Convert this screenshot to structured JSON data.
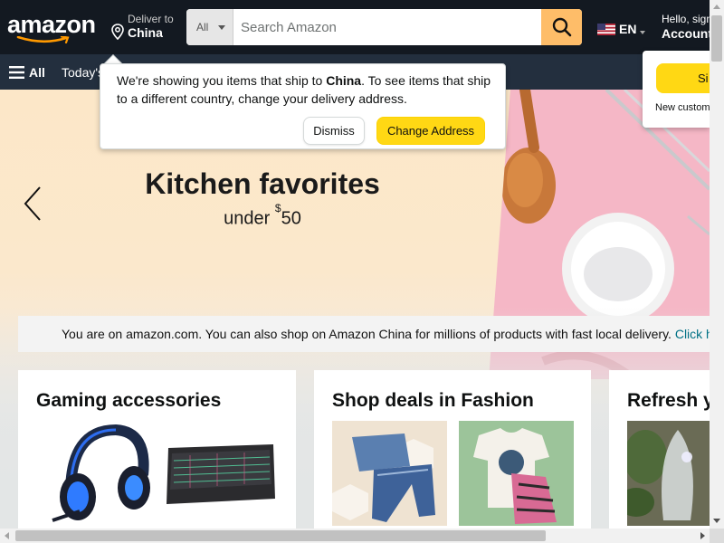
{
  "header": {
    "logo_text": "amazon",
    "deliver_label": "Deliver to",
    "deliver_country": "China",
    "search": {
      "category": "All",
      "placeholder": "Search Amazon"
    },
    "language": "EN",
    "account_greeting": "Hello, sign",
    "account_label": "Account"
  },
  "subnav": {
    "all_label": "All",
    "today_deals": "Today's"
  },
  "popover": {
    "message_prefix": "We're showing you items that ship to ",
    "message_country": "China",
    "message_suffix": ". To see items that ship to a different country, change your delivery address.",
    "dismiss_label": "Dismiss",
    "change_label": "Change Address"
  },
  "signin_flyout": {
    "button_label": "Si",
    "new_customer": "New custom"
  },
  "hero": {
    "title": "Kitchen favorites",
    "subtitle_prefix": "under ",
    "subtitle_currency": "$",
    "subtitle_amount": "50"
  },
  "notice": {
    "text": "You are on amazon.com. You can also shop on Amazon China for millions of products with fast local delivery. ",
    "link": "Click h"
  },
  "cards": [
    {
      "title": "Gaming accessories"
    },
    {
      "title": "Shop deals in Fashion"
    },
    {
      "title": "Refresh y"
    }
  ],
  "colors": {
    "nav_dark": "#131921",
    "nav_sub": "#232f3e",
    "search_button": "#febd69",
    "primary_button": "#ffd814",
    "link": "#007185",
    "smile": "#ff9900"
  }
}
